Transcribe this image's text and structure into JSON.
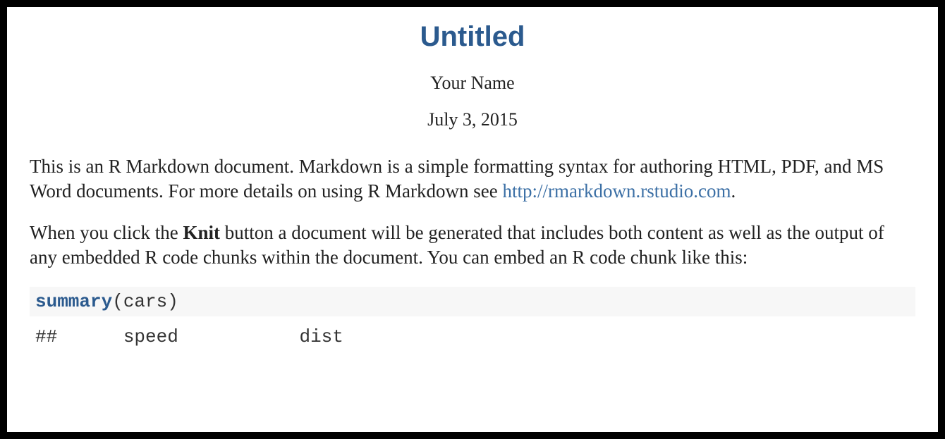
{
  "title": "Untitled",
  "author": "Your Name",
  "date": "July 3, 2015",
  "intro": {
    "pre_link": "This is an R Markdown document. Markdown is a simple formatting syntax for authoring HTML, PDF, and MS Word documents. For more details on using R Markdown see ",
    "link_text": "http://rmarkdown.rstudio.com",
    "link_href": "http://rmarkdown.rstudio.com",
    "post_link": "."
  },
  "knit": {
    "pre_bold": "When you click the ",
    "bold": "Knit",
    "post_bold": " button a document will be generated that includes both content as well as the output of any embedded R code chunks within the document. You can embed an R code chunk like this:"
  },
  "code": {
    "fn": "summary",
    "args": "(cars)"
  },
  "output_line": "##      speed           dist"
}
